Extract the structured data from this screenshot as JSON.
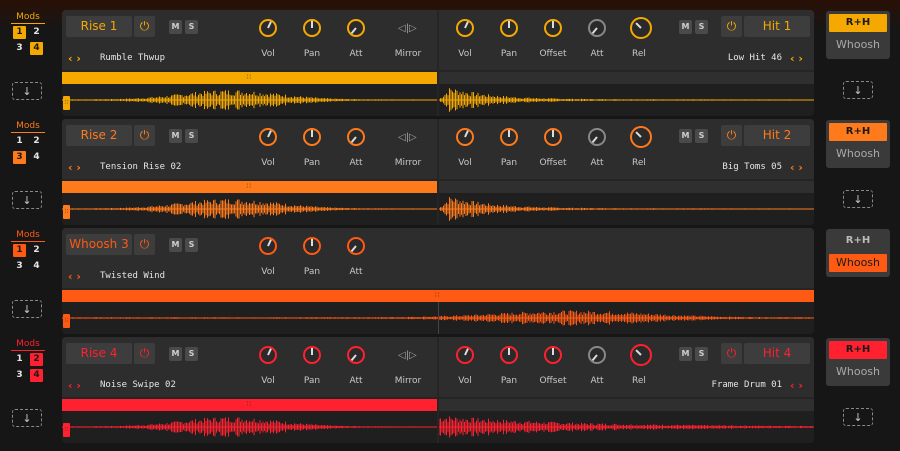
{
  "mods_label": "Mods",
  "colors": {
    "lane1": "#f5a900",
    "lane2": "#ff7a1a",
    "lane3": "#ff5a14",
    "lane4": "#ff2030",
    "panel": "#2d2d2d",
    "text": "#e6e6e6"
  },
  "lanes": [
    {
      "left_name": "Rise 1",
      "right_name": "Hit 1",
      "left_sample": "Rumble Thwup",
      "right_sample": "Low Hit 46",
      "mod_nums": [
        "1",
        "2",
        "3",
        "4"
      ],
      "mod_active": [
        true,
        false,
        false,
        true
      ],
      "knobs_left": [
        "Vol",
        "Pan",
        "Att"
      ],
      "mirror": "Mirror",
      "knobs_right": [
        "Vol",
        "Pan",
        "Offset",
        "Att",
        "Rel"
      ],
      "m": "M",
      "s": "S",
      "side_rh": "R+H",
      "side_wh": "Whoosh",
      "side_active": "rh",
      "has_right": true
    },
    {
      "left_name": "Rise 2",
      "right_name": "Hit 2",
      "left_sample": "Tension Rise 02",
      "right_sample": "Big Toms 05",
      "mod_nums": [
        "1",
        "2",
        "3",
        "4"
      ],
      "mod_active": [
        false,
        false,
        true,
        false
      ],
      "knobs_left": [
        "Vol",
        "Pan",
        "Att"
      ],
      "mirror": "Mirror",
      "knobs_right": [
        "Vol",
        "Pan",
        "Offset",
        "Att",
        "Rel"
      ],
      "m": "M",
      "s": "S",
      "side_rh": "R+H",
      "side_wh": "Whoosh",
      "side_active": "rh",
      "has_right": true
    },
    {
      "left_name": "Whoosh 3",
      "right_name": "",
      "left_sample": "Twisted Wind",
      "right_sample": "",
      "mod_nums": [
        "1",
        "2",
        "3",
        "4"
      ],
      "mod_active": [
        true,
        false,
        false,
        false
      ],
      "knobs_left": [
        "Vol",
        "Pan",
        "Att"
      ],
      "mirror": "",
      "knobs_right": [],
      "m": "M",
      "s": "S",
      "side_rh": "R+H",
      "side_wh": "Whoosh",
      "side_active": "wh",
      "has_right": false
    },
    {
      "left_name": "Rise 4",
      "right_name": "Hit 4",
      "left_sample": "Noise Swipe 02",
      "right_sample": "Frame Drum 01",
      "mod_nums": [
        "1",
        "2",
        "3",
        "4"
      ],
      "mod_active": [
        false,
        true,
        false,
        true
      ],
      "knobs_left": [
        "Vol",
        "Pan",
        "Att"
      ],
      "mirror": "Mirror",
      "knobs_right": [
        "Vol",
        "Pan",
        "Offset",
        "Att",
        "Rel"
      ],
      "m": "M",
      "s": "S",
      "side_rh": "R+H",
      "side_wh": "Whoosh",
      "side_active": "rh",
      "has_right": true
    }
  ]
}
